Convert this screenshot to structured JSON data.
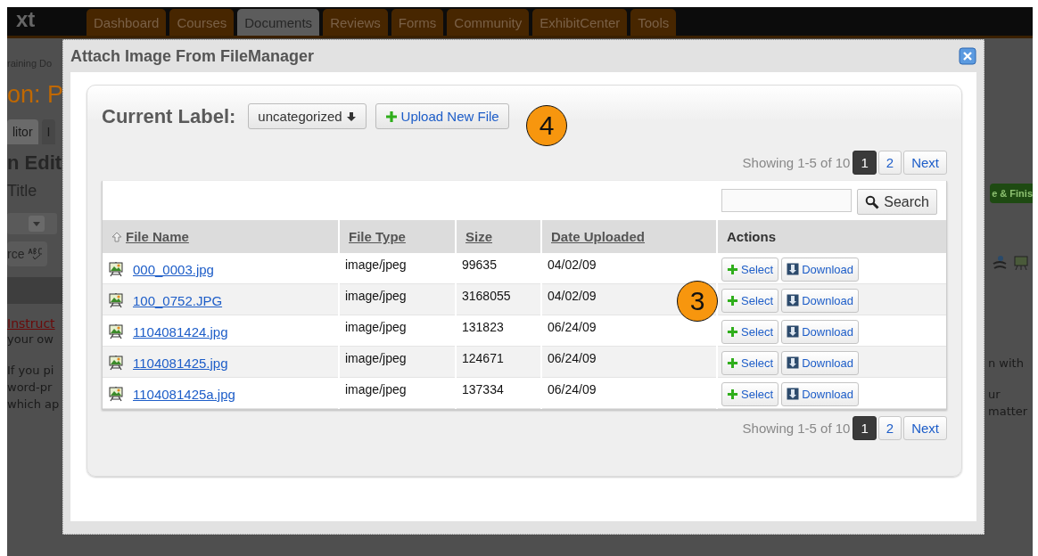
{
  "background_page": {
    "logo": "xt",
    "nav_tabs": [
      {
        "label": "Dashboard",
        "selected": false
      },
      {
        "label": "Courses",
        "selected": false
      },
      {
        "label": "Documents",
        "selected": true
      },
      {
        "label": "Reviews",
        "selected": false
      },
      {
        "label": "Forms",
        "selected": false
      },
      {
        "label": "Community",
        "selected": false
      },
      {
        "label": "ExhibitCenter",
        "selected": false
      },
      {
        "label": "Tools",
        "selected": false
      }
    ],
    "breadcrumb": "raining Do",
    "heading": "on: P",
    "editor_tabs": [
      {
        "label": "litor",
        "selected": true
      },
      {
        "label": "I",
        "selected": false
      }
    ],
    "section_title": "n Edit",
    "field_label": "Title",
    "source_label": "rce",
    "instructions_link": "Instruct",
    "paragraph_lines": [
      "your ow",
      "If you pi",
      "word-pr",
      "which ap"
    ],
    "save_button": "e & Finis",
    "right_lines": [
      "n with",
      "ur",
      "matter"
    ]
  },
  "dialog": {
    "title": "Attach Image From FileManager",
    "current_label": "Current Label:",
    "label_dropdown": "uncategorized",
    "upload_button": "Upload New File",
    "pagination_top": {
      "summary": "Showing 1-5 of 10",
      "pages": [
        {
          "label": "1",
          "selected": true
        },
        {
          "label": "2",
          "selected": false
        }
      ],
      "next": "Next"
    },
    "search_button": "Search",
    "table": {
      "columns": [
        {
          "label": "File Name",
          "sortable": true,
          "sorted": true
        },
        {
          "label": "File Type",
          "sortable": true,
          "sorted": false
        },
        {
          "label": "Size",
          "sortable": true,
          "sorted": false
        },
        {
          "label": "Date Uploaded",
          "sortable": true,
          "sorted": false
        },
        {
          "label": "Actions",
          "sortable": false,
          "sorted": false
        }
      ],
      "rows": [
        {
          "file_name": "000_0003.jpg",
          "file_type": "image/jpeg",
          "size": "99635",
          "date": "04/02/09",
          "select": "Select",
          "download": "Download"
        },
        {
          "file_name": "100_0752.JPG",
          "file_type": "image/jpeg",
          "size": "3168055",
          "date": "04/02/09",
          "select": "Select",
          "download": "Download"
        },
        {
          "file_name": "1104081424.jpg",
          "file_type": "image/jpeg",
          "size": "131823",
          "date": "06/24/09",
          "select": "Select",
          "download": "Download"
        },
        {
          "file_name": "1104081425.jpg",
          "file_type": "image/jpeg",
          "size": "124671",
          "date": "06/24/09",
          "select": "Select",
          "download": "Download"
        },
        {
          "file_name": "1104081425a.jpg",
          "file_type": "image/jpeg",
          "size": "137334",
          "date": "06/24/09",
          "select": "Select",
          "download": "Download"
        }
      ]
    },
    "pagination_bottom": {
      "summary": "Showing 1-5 of 10",
      "pages": [
        {
          "label": "1",
          "selected": true
        },
        {
          "label": "2",
          "selected": false
        }
      ],
      "next": "Next"
    }
  },
  "callouts": [
    {
      "label": "4"
    },
    {
      "label": "3"
    }
  ]
}
